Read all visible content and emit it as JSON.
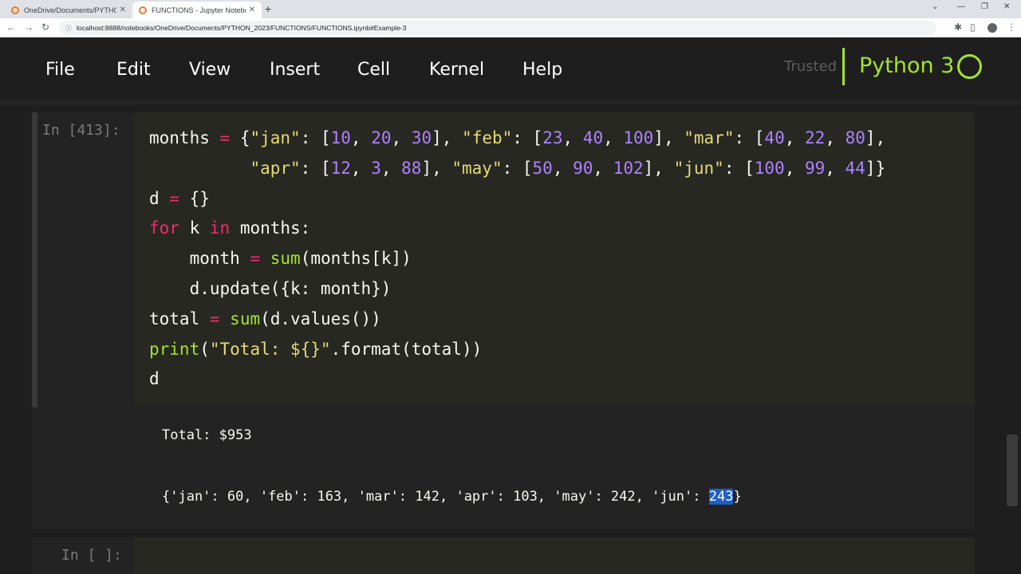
{
  "browser": {
    "tabs": [
      {
        "title": "OneDrive/Documents/PYTHON_"
      },
      {
        "title": "FUNCTIONS - Jupyter Notebook"
      }
    ],
    "new_tab": "+",
    "address": "localhost:8888/notebooks/OneDrive/Documents/PYTHON_2023/FUNCTIONS/FUNCTIONS.ipynb#Example-3"
  },
  "menu": {
    "file": "File",
    "edit": "Edit",
    "view": "View",
    "insert": "Insert",
    "cell": "Cell",
    "kernel": "Kernel",
    "help": "Help"
  },
  "status": {
    "trusted": "Trusted",
    "kernel": "Python 3"
  },
  "cells": [
    {
      "prompt": "In [413]:",
      "code": [
        "months = {\"jan\": [10, 20, 30], \"feb\": [23, 40, 100], \"mar\": [40, 22, 80],",
        "          \"apr\": [12, 3, 88], \"may\": [50, 90, 102], \"jun\": [100, 99, 44]}",
        "d = {}",
        "for k in months:",
        "    month = sum(months[k])",
        "    d.update({k: month})",
        "total = sum(d.values())",
        "print(\"Total: ${}\".format(total))",
        "d"
      ],
      "output_stdout": "Total: $953",
      "output_result_prefix": "{'jan': 60, 'feb': 163, 'mar': 142, 'apr': 103, 'may': 242, 'jun': ",
      "output_result_selected": "243",
      "output_result_suffix": "}"
    },
    {
      "prompt": "In [ ]:"
    }
  ],
  "colors": {
    "keyword": "#f92672",
    "string": "#e6db74",
    "number": "#ae81ff",
    "builtin": "#a6e22e",
    "kernel_accent": "#a6e22e",
    "selection": "#1f5fc6"
  }
}
